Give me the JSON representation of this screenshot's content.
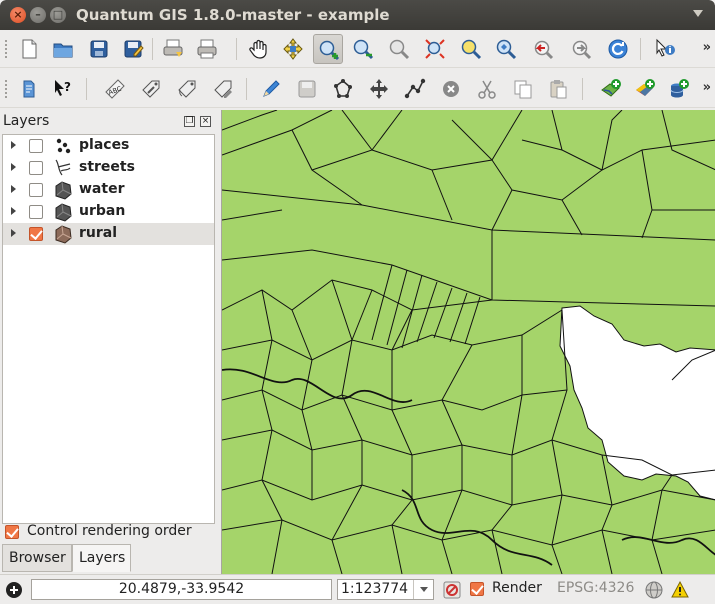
{
  "window": {
    "title": "Quantum GIS 1.8.0-master - example",
    "close_glyph": "×",
    "min_glyph": "–",
    "max_glyph": "□"
  },
  "toolbar1": {
    "icons": [
      "new-project-icon",
      "open-project-icon",
      "save-project-icon",
      "save-as-icon",
      "print-composer-icon",
      "print-icon",
      "pan-icon",
      "pan-to-selection-icon",
      "zoom-in-icon",
      "zoom-out-icon",
      "zoom-actual-icon",
      "zoom-full-icon",
      "zoom-to-selection-icon",
      "zoom-to-layer-icon",
      "zoom-last-icon",
      "zoom-next-icon",
      "refresh-icon",
      "identify-icon"
    ],
    "more": "»"
  },
  "toolbar2": {
    "icons": [
      "edit-annotation-icon",
      "whats-this-icon",
      "label-icon",
      "move-label-icon",
      "rotate-label-icon",
      "change-label-icon",
      "toggle-editing-icon",
      "save-edits-icon",
      "add-feature-icon",
      "move-feature-icon",
      "node-tool-icon",
      "delete-selected-icon",
      "cut-features-icon",
      "copy-features-icon",
      "paste-features-icon",
      "add-vector-layer-icon",
      "add-raster-layer-icon",
      "add-postgis-layer-icon"
    ],
    "more": "»"
  },
  "layers_panel": {
    "title": "Layers",
    "float_glyph": "❐",
    "close_glyph": "×",
    "layers": [
      {
        "name": "places",
        "checked": false,
        "icon": "point-layer-icon"
      },
      {
        "name": "streets",
        "checked": false,
        "icon": "line-layer-icon"
      },
      {
        "name": "water",
        "checked": false,
        "icon": "polygon-layer-icon"
      },
      {
        "name": "urban",
        "checked": false,
        "icon": "polygon-layer-icon"
      },
      {
        "name": "rural",
        "checked": true,
        "icon": "polygon-layer-icon"
      }
    ],
    "control_rendering_order": "Control rendering order",
    "tabs": [
      "Browser",
      "Layers"
    ],
    "active_tab": "Layers"
  },
  "map": {
    "fill_color": "#a5d46a",
    "water_color": "#ffffff",
    "line_color": "#1a1a1a"
  },
  "statusbar": {
    "coordinates": "20.4879,-33.9542",
    "scale": "1:123774",
    "render_label": "Render",
    "render_checked": true,
    "crs": "EPSG:4326"
  }
}
